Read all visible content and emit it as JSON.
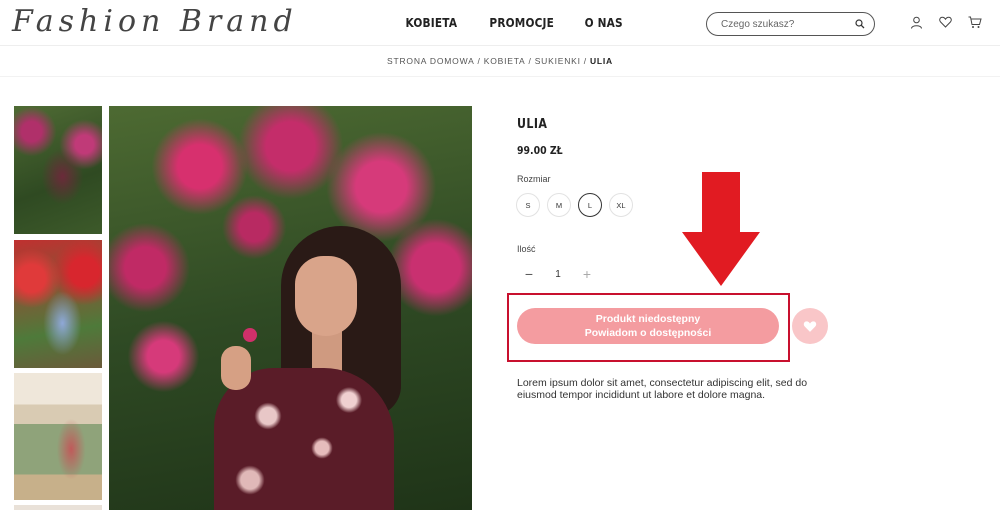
{
  "brand": {
    "logo_text": "Fashion Brand"
  },
  "nav": {
    "items": [
      "KOBIETA",
      "PROMOCJE",
      "O NAS"
    ]
  },
  "search": {
    "placeholder": "Czego szukasz?"
  },
  "header_icons": [
    "user-icon",
    "heart-icon",
    "cart-icon"
  ],
  "breadcrumb": {
    "items": [
      "STRONA DOMOWA",
      "KOBIETA",
      "SUKIENKI"
    ],
    "current": "ULIA"
  },
  "gallery": {
    "thumb_count": 4
  },
  "product": {
    "name": "ULIA",
    "price": "99.00 ZŁ",
    "size_label": "Rozmiar",
    "sizes": [
      "S",
      "M",
      "L",
      "XL"
    ],
    "selected_size": "L",
    "qty_label": "Ilość",
    "qty_value": "1",
    "cta_line1": "Produkt niedostępny",
    "cta_line2": "Powiadom o dostępności",
    "description": "Lorem ipsum dolor sit amet, consectetur adipiscing elit, sed do eiusmod tempor incididunt ut labore et dolore magna."
  },
  "colors": {
    "cta": "#f49ca0",
    "fav": "#f9c6c8",
    "highlight": "#c8102e",
    "arrow": "#e11b22"
  }
}
